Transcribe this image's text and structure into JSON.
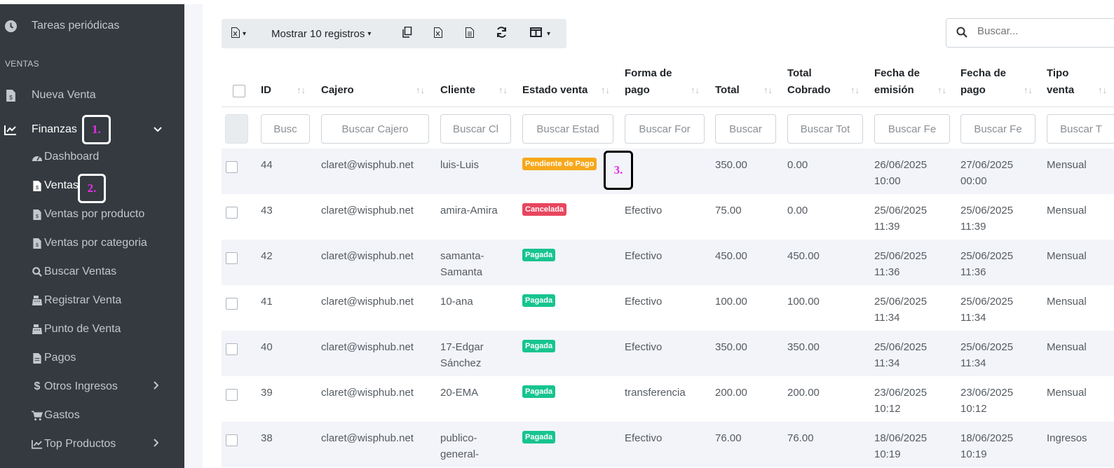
{
  "sidebar": {
    "top_item": "Tareas periódicas",
    "section_heading": "VENTAS",
    "nueva_venta": "Nueva Venta",
    "finanzas": "Finanzas",
    "sub_items": [
      {
        "label": "Dashboard",
        "icon": "dashboard-icon"
      },
      {
        "label": "Ventas",
        "icon": "file-invoice-icon"
      },
      {
        "label": "Ventas por producto",
        "icon": "file-invoice-icon"
      },
      {
        "label": "Ventas por categoria",
        "icon": "file-invoice-icon"
      },
      {
        "label": "Buscar Ventas",
        "icon": "search-icon"
      },
      {
        "label": "Registrar Venta",
        "icon": "cash-register-icon"
      },
      {
        "label": "Punto de Venta",
        "icon": "cash-register-icon"
      },
      {
        "label": "Pagos",
        "icon": "file-icon"
      },
      {
        "label": "Otros Ingresos",
        "icon": "dollar-icon"
      },
      {
        "label": "Gastos",
        "icon": "cart-icon"
      },
      {
        "label": "Top Productos",
        "icon": "chart-icon"
      }
    ]
  },
  "annotations": [
    "1.",
    "2.",
    "3."
  ],
  "toolbar": {
    "show_records": "Mostrar 10 registros",
    "icons": [
      "export-excel-icon",
      "copy-icon",
      "excel-icon",
      "csv-icon",
      "refresh-icon",
      "columns-icon"
    ]
  },
  "search": {
    "placeholder": "Buscar..."
  },
  "table": {
    "headers": [
      {
        "l1": "",
        "l2": "ID"
      },
      {
        "l1": "",
        "l2": "Cajero"
      },
      {
        "l1": "",
        "l2": "Cliente"
      },
      {
        "l1": "",
        "l2": "Estado venta"
      },
      {
        "l1": "Forma de",
        "l2": "pago"
      },
      {
        "l1": "",
        "l2": "Total"
      },
      {
        "l1": "Total",
        "l2": "Cobrado"
      },
      {
        "l1": "Fecha de",
        "l2": "emisión"
      },
      {
        "l1": "Fecha de",
        "l2": "pago"
      },
      {
        "l1": "Tipo",
        "l2": "venta"
      }
    ],
    "filters": [
      "Busc",
      "Buscar Cajero",
      "Buscar Cl",
      "Buscar Estad",
      "Buscar For",
      "Buscar",
      "Buscar Tot",
      "Buscar Fe",
      "Buscar Fe",
      "Buscar T"
    ],
    "rows": [
      {
        "id": "44",
        "cajero": "claret@wisphub.net",
        "cliente": [
          "luis-Luis"
        ],
        "estado": "Pendiente de Pago",
        "estado_color": "#f7a81b",
        "forma": "",
        "total": "350.00",
        "cobrado": "0.00",
        "emision": [
          "26/06/2025",
          "10:00"
        ],
        "pago": [
          "27/06/2025",
          "00:00"
        ],
        "tipo": "Mensual"
      },
      {
        "id": "43",
        "cajero": "claret@wisphub.net",
        "cliente": [
          "amira-Amira"
        ],
        "estado": "Cancelada",
        "estado_color": "#e8465f",
        "forma": "Efectivo",
        "total": "75.00",
        "cobrado": "0.00",
        "emision": [
          "25/06/2025",
          "11:39"
        ],
        "pago": [
          "25/06/2025",
          "11:39"
        ],
        "tipo": "Mensual"
      },
      {
        "id": "42",
        "cajero": "claret@wisphub.net",
        "cliente": [
          "samanta-",
          "Samanta"
        ],
        "estado": "Pagada",
        "estado_color": "#17c48f",
        "forma": "Efectivo",
        "total": "450.00",
        "cobrado": "450.00",
        "emision": [
          "25/06/2025",
          "11:36"
        ],
        "pago": [
          "25/06/2025",
          "11:36"
        ],
        "tipo": "Mensual"
      },
      {
        "id": "41",
        "cajero": "claret@wisphub.net",
        "cliente": [
          "10-ana"
        ],
        "estado": "Pagada",
        "estado_color": "#17c48f",
        "forma": "Efectivo",
        "total": "100.00",
        "cobrado": "100.00",
        "emision": [
          "25/06/2025",
          "11:34"
        ],
        "pago": [
          "25/06/2025",
          "11:34"
        ],
        "tipo": "Mensual"
      },
      {
        "id": "40",
        "cajero": "claret@wisphub.net",
        "cliente": [
          "17-Edgar",
          "Sánchez"
        ],
        "estado": "Pagada",
        "estado_color": "#17c48f",
        "forma": "Efectivo",
        "total": "350.00",
        "cobrado": "350.00",
        "emision": [
          "25/06/2025",
          "11:34"
        ],
        "pago": [
          "25/06/2025",
          "11:34"
        ],
        "tipo": "Mensual"
      },
      {
        "id": "39",
        "cajero": "claret@wisphub.net",
        "cliente": [
          "20-EMA"
        ],
        "estado": "Pagada",
        "estado_color": "#17c48f",
        "forma": "transferencia",
        "total": "200.00",
        "cobrado": "200.00",
        "emision": [
          "23/06/2025",
          "10:12"
        ],
        "pago": [
          "23/06/2025",
          "10:12"
        ],
        "tipo": "Mensual"
      },
      {
        "id": "38",
        "cajero": "claret@wisphub.net",
        "cliente": [
          "publico-",
          "general-"
        ],
        "estado": "Pagada",
        "estado_color": "#17c48f",
        "forma": "Efectivo",
        "total": "76.00",
        "cobrado": "76.00",
        "emision": [
          "18/06/2025",
          "10:19"
        ],
        "pago": [
          "18/06/2025",
          "10:19"
        ],
        "tipo": "Ingresos"
      }
    ]
  }
}
